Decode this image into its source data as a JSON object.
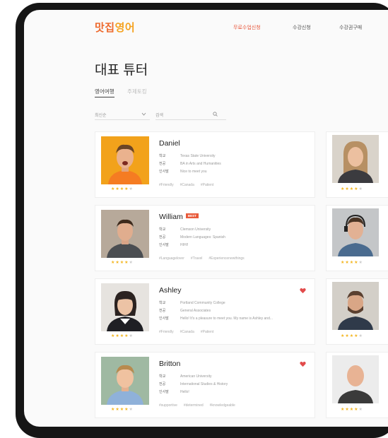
{
  "header": {
    "logo_part1": "맛집",
    "logo_part2": "영어",
    "nav": [
      {
        "label": "무료수업신청",
        "active": true
      },
      {
        "label": "수강신청",
        "active": false
      },
      {
        "label": "수강권구매",
        "active": false
      }
    ]
  },
  "page_title": "대표 튜터",
  "tabs": [
    {
      "label": "영어여행",
      "active": true
    },
    {
      "label": "주제토킹",
      "active": false
    }
  ],
  "filter": {
    "sort_value": "최신순",
    "search_placeholder": "검색"
  },
  "labels": {
    "school": "학교",
    "major": "전공",
    "greeting": "인사말",
    "best_badge": "BEST"
  },
  "colors": {
    "accent": "#e8563a",
    "star": "#f3b51f",
    "heart": "#e24b4b"
  },
  "tutors": [
    {
      "name": "Daniel",
      "best": false,
      "favorited": false,
      "school": "Texas State University",
      "major": "BA in Arts and Humanities",
      "greeting": "Nice to meet you",
      "tags": [
        "#Friendly",
        "#Canada",
        "#Patient"
      ],
      "rating": 4
    },
    {
      "name": "William",
      "best": true,
      "favorited": false,
      "school": "Clemson University",
      "major": "Modern Languages: Spanish",
      "greeting": "HIHI!",
      "tags": [
        "#Languagelover",
        "#Travel",
        "#Experiencenewthings"
      ],
      "rating": 4
    },
    {
      "name": "Ashley",
      "best": false,
      "favorited": true,
      "school": "Portland Community College",
      "major": "General Associates",
      "greeting": "Hello! It's a pleasure to meet you. My name is Ashley and...",
      "tags": [
        "#Friendly",
        "#Canada",
        "#Patient"
      ],
      "rating": 4
    },
    {
      "name": "Britton",
      "best": false,
      "favorited": true,
      "school": "American University",
      "major": "International Studies & History",
      "greeting": "Hello!",
      "tags": [
        "#supportive",
        "#determined",
        "#knowledgeable"
      ],
      "rating": 4
    }
  ],
  "right_column_ratings": [
    4,
    4,
    4,
    4
  ]
}
